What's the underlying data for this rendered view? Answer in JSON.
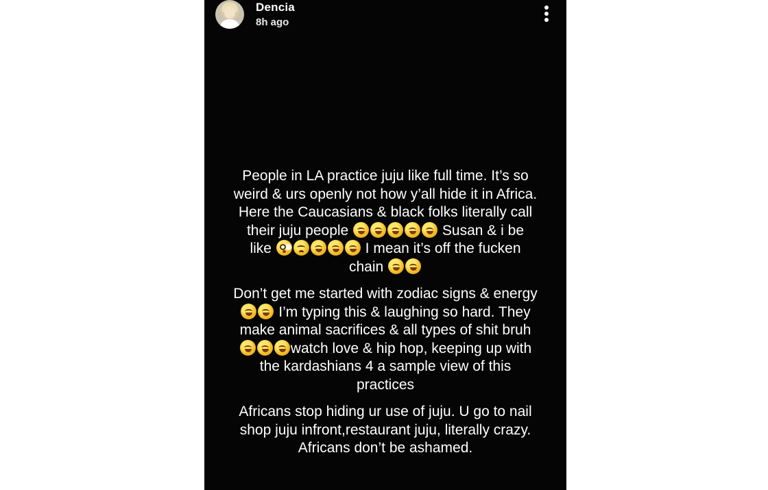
{
  "story": {
    "username": "Dencia",
    "timestamp": "8h ago",
    "menu_icon": "more-vertical-icon",
    "emoji_icons": {
      "laughing": "rolling-on-floor-laughing-emoji",
      "shocked": "flushed-face-emoji",
      "crying": "crying-face-emoji"
    },
    "paragraphs": [
      {
        "lines": [
          {
            "text": "People in LA practice juju like full time. It’s so",
            "emojis_after": 0
          },
          {
            "text": "weird & urs openly not how y’all hide it in Africa.",
            "emojis_after": 0
          },
          {
            "text": "Here the Caucasians & black folks literally call",
            "emojis_after": 0
          },
          {
            "text": "their juju people",
            "emojis_after": 5,
            "rest": " Susan & i be"
          },
          {
            "text": "like",
            "emojis_prefix": [
              "shocked",
              "crying",
              "laughing",
              "laughing",
              "laughing"
            ],
            "rest": " I mean it’s off the fucken"
          },
          {
            "text": "chain",
            "emojis_after": 2
          }
        ]
      },
      {
        "lines": [
          {
            "text": "Don’t get me started with zodiac signs & energy",
            "emojis_after": 0
          },
          {
            "text": "",
            "emojis_prefix_count": 2,
            "rest": " I’m typing this & laughing so hard. They"
          },
          {
            "text": "make animal sacrifices & all types of shit bruh",
            "emojis_after": 0
          },
          {
            "text": "",
            "emojis_prefix_count": 3,
            "rest": "watch love & hip hop, keeping up with"
          },
          {
            "text": "the kardashians 4 a sample view of this",
            "emojis_after": 0
          },
          {
            "text": "practices",
            "emojis_after": 0
          }
        ]
      },
      {
        "lines": [
          {
            "text": "Africans stop hiding ur use of juju. U go to nail",
            "emojis_after": 0
          },
          {
            "text": "shop juju infront,restaurant juju, literally crazy.",
            "emojis_after": 0
          },
          {
            "text": "Africans don’t be ashamed.",
            "emojis_after": 0
          }
        ]
      }
    ]
  }
}
